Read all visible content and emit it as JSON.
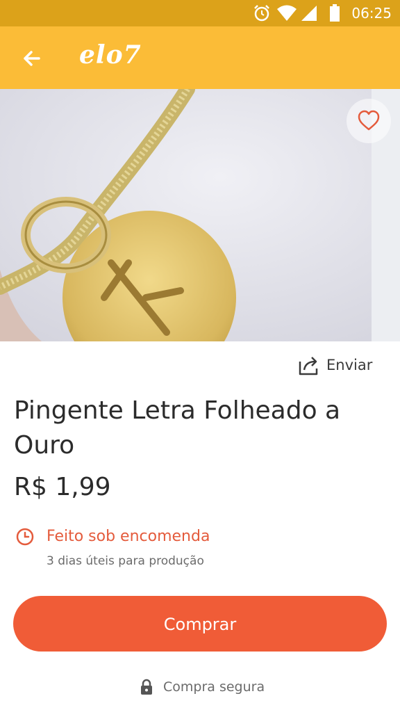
{
  "status_bar": {
    "time": "06:25",
    "icons": [
      "alarm-icon",
      "wifi-icon",
      "signal-icon",
      "battery-icon"
    ]
  },
  "app_bar": {
    "logo": "elo7",
    "back_icon": "arrow-left-icon",
    "color": "#fbbc37"
  },
  "product": {
    "image_description_icon": "pendant-image",
    "favorite_icon": "heart-icon",
    "share_label": "Enviar",
    "share_icon": "share-icon",
    "title": "Pingente Letra Folheado a Ouro",
    "price": "R$ 1,99",
    "lead_time": {
      "icon": "clock-icon",
      "title": "Feito sob encomenda",
      "subtitle": "3 dias úteis para produção"
    }
  },
  "actions": {
    "buy_label": "Comprar",
    "buy_color": "#f05c37",
    "secure_label": "Compra segura",
    "secure_icon": "lock-icon"
  }
}
